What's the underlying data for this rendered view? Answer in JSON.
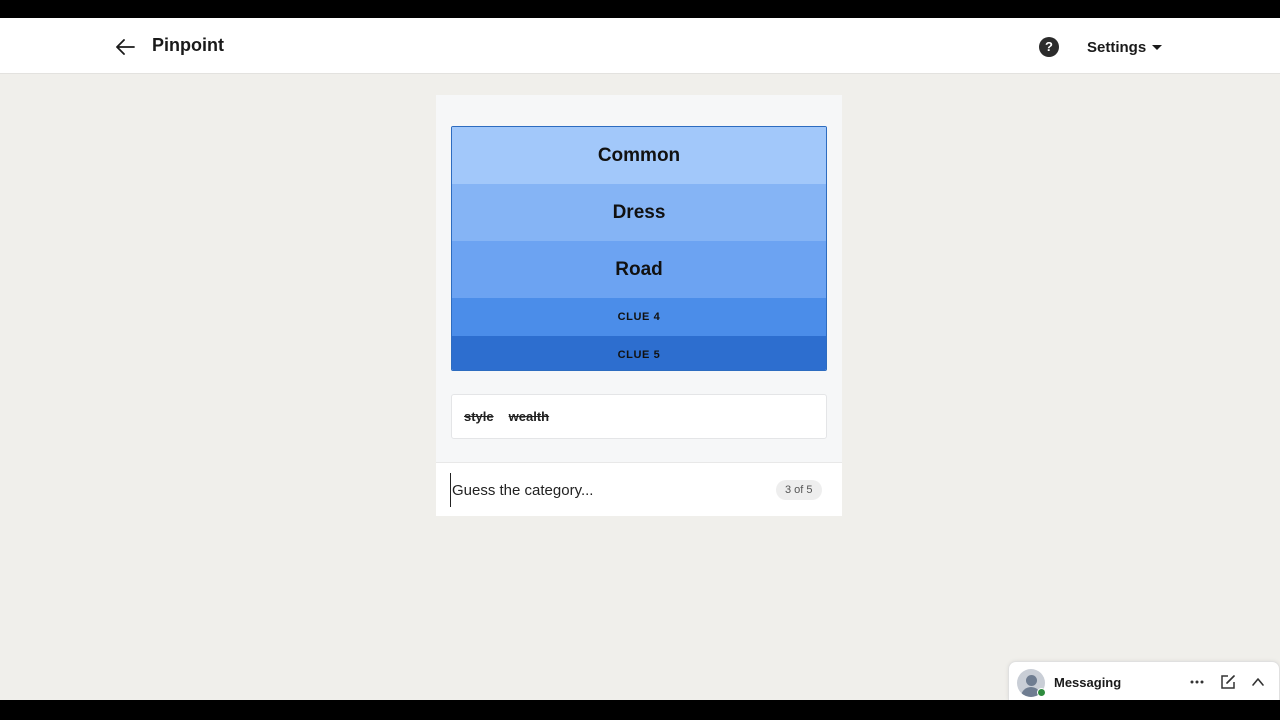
{
  "header": {
    "title": "Pinpoint",
    "settings_label": "Settings",
    "help_symbol": "?",
    "icons": {
      "back": "arrow-left-icon",
      "help": "question-circle-icon",
      "settings": "chevron-down-icon"
    }
  },
  "game": {
    "clues": [
      {
        "label": "Common",
        "revealed": true
      },
      {
        "label": "Dress",
        "revealed": true
      },
      {
        "label": "Road",
        "revealed": true
      },
      {
        "label": "CLUE 4",
        "revealed": false
      },
      {
        "label": "CLUE 5",
        "revealed": false
      }
    ],
    "wrong_guesses": [
      "style",
      "wealth"
    ],
    "input_placeholder": "Guess the category...",
    "attempt_counter": "3 of 5",
    "colors": [
      "#a2c8fa",
      "#85b4f5",
      "#6ca3f2",
      "#4b8de9",
      "#2d6ecf"
    ]
  },
  "messaging": {
    "label": "Messaging",
    "icons": [
      "more-horizontal-icon",
      "compose-icon",
      "chevron-up-icon"
    ],
    "presence_color": "#2e8b3d"
  }
}
